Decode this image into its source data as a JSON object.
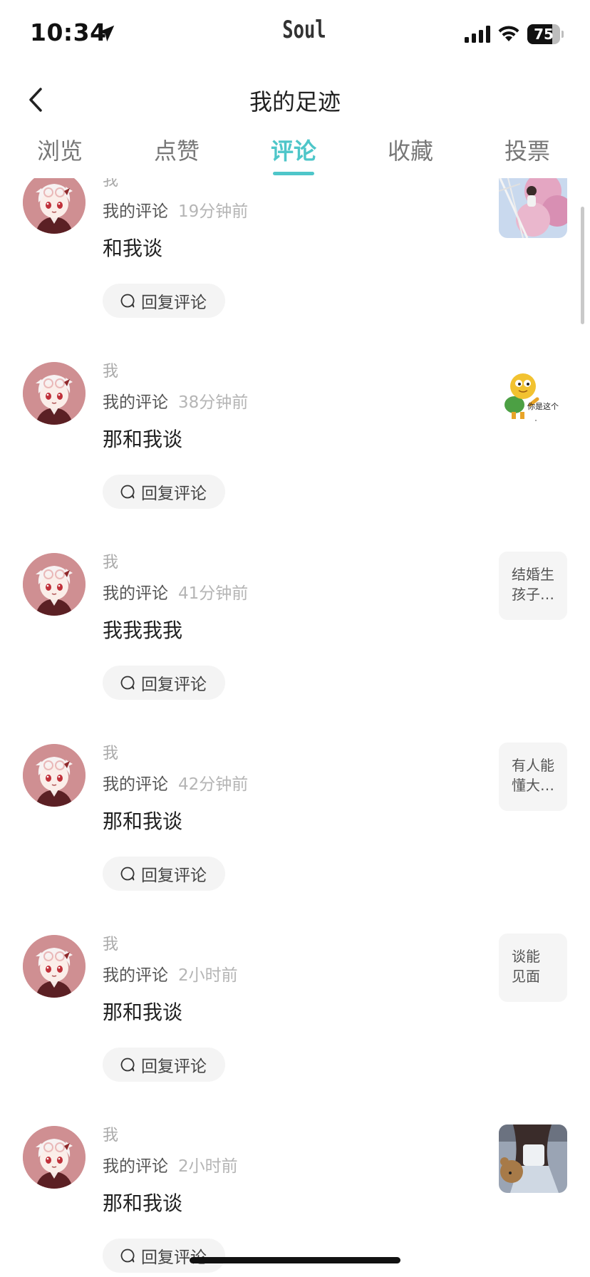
{
  "status_bar": {
    "time": "10:34",
    "app_logo": "Soul",
    "battery": "75",
    "battery_level": 0.75,
    "icons": [
      "location-arrow-icon",
      "signal-icon",
      "wifi-icon",
      "battery-icon"
    ]
  },
  "header": {
    "title": "我的足迹",
    "back_icon": "chevron-left-icon"
  },
  "tabs": [
    {
      "label": "浏览",
      "active": false
    },
    {
      "label": "点赞",
      "active": false
    },
    {
      "label": "评论",
      "active": true
    },
    {
      "label": "收藏",
      "active": false
    },
    {
      "label": "投票",
      "active": false
    }
  ],
  "accent_color": "#4ec6c9",
  "comments": [
    {
      "name": "我",
      "label": "我的评论",
      "time": "19分钟前",
      "text": "和我谈",
      "reply_label": "回复评论",
      "thumb": {
        "kind": "photo-cherry-blossom"
      }
    },
    {
      "name": "我",
      "label": "我的评论",
      "time": "38分钟前",
      "text": "那和我谈",
      "reply_label": "回复评论",
      "thumb": {
        "kind": "sticker-turtle",
        "caption": "你是这个"
      }
    },
    {
      "name": "我",
      "label": "我的评论",
      "time": "41分钟前",
      "text": "我我我我",
      "reply_label": "回复评论",
      "thumb": {
        "kind": "text",
        "lines": [
          "结婚生",
          "孩子…"
        ]
      }
    },
    {
      "name": "我",
      "label": "我的评论",
      "time": "42分钟前",
      "text": "那和我谈",
      "reply_label": "回复评论",
      "thumb": {
        "kind": "text",
        "lines": [
          "有人能",
          "懂大…"
        ]
      }
    },
    {
      "name": "我",
      "label": "我的评论",
      "time": "2小时前",
      "text": "那和我谈",
      "reply_label": "回复评论",
      "thumb": {
        "kind": "text",
        "lines": [
          "谈能",
          "见面"
        ]
      }
    },
    {
      "name": "我",
      "label": "我的评论",
      "time": "2小时前",
      "text": "那和我谈",
      "reply_label": "回复评论",
      "thumb": {
        "kind": "photo-girl-bear"
      }
    }
  ]
}
